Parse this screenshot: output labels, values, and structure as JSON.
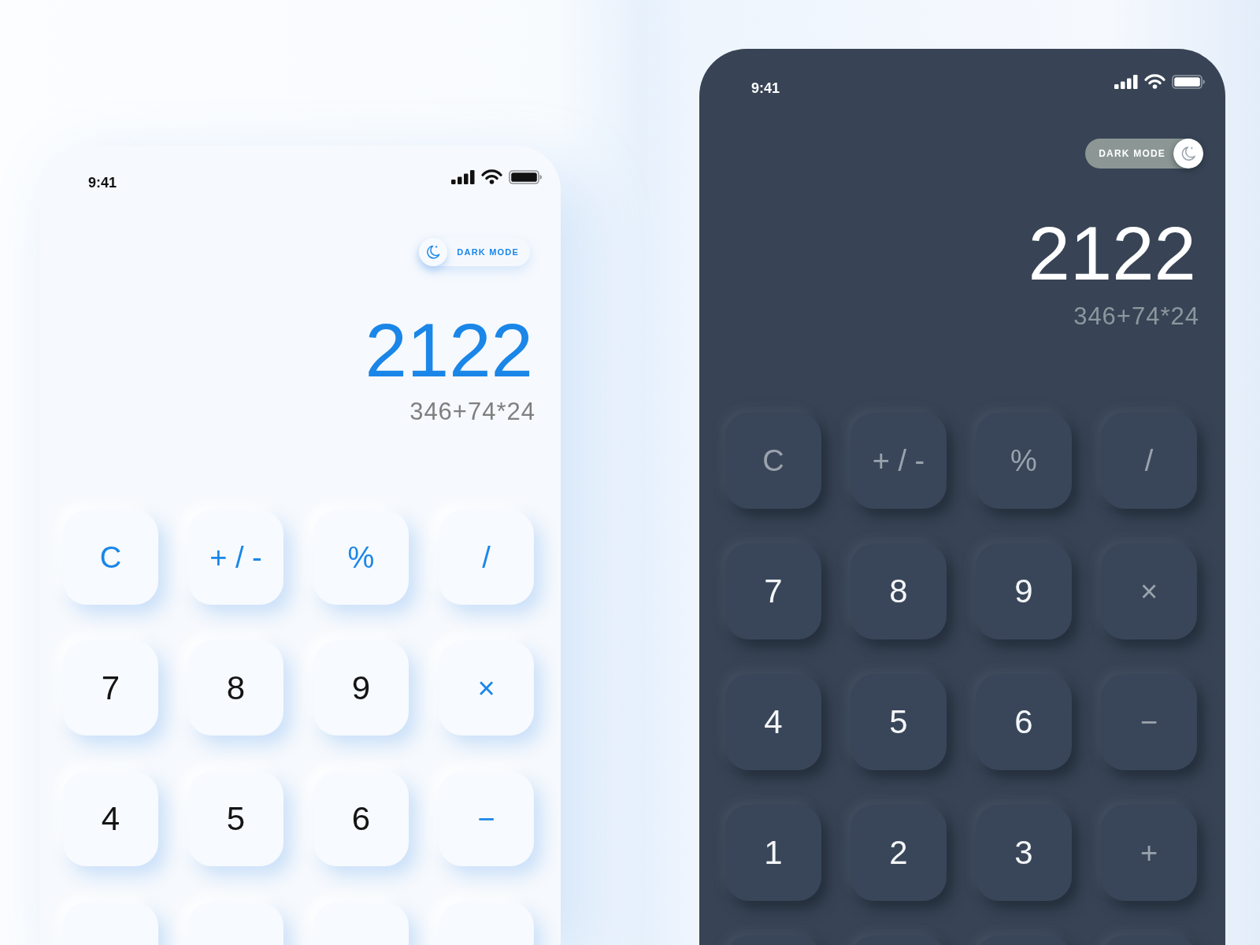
{
  "phones": [
    {
      "status_bar": {
        "time": "9:41"
      },
      "dark_mode_toggle": {
        "label": "DARK MODE",
        "on": false
      },
      "display": {
        "result": "2122",
        "expression": "346+74*24"
      },
      "keys": [
        {
          "label": "C",
          "kind": "operator"
        },
        {
          "label": "+ / -",
          "kind": "operator"
        },
        {
          "label": "%",
          "kind": "operator"
        },
        {
          "label": "/",
          "kind": "operator"
        },
        {
          "label": "7",
          "kind": "digit"
        },
        {
          "label": "8",
          "kind": "digit"
        },
        {
          "label": "9",
          "kind": "digit"
        },
        {
          "label": "×",
          "kind": "operator"
        },
        {
          "label": "4",
          "kind": "digit"
        },
        {
          "label": "5",
          "kind": "digit"
        },
        {
          "label": "6",
          "kind": "digit"
        },
        {
          "label": "−",
          "kind": "operator"
        },
        {
          "kind": "digit"
        },
        {
          "kind": "digit"
        },
        {
          "kind": "digit"
        },
        {
          "kind": "operator"
        }
      ]
    },
    {
      "status_bar": {
        "time": "9:41"
      },
      "dark_mode_toggle": {
        "label": "DARK MODE",
        "on": true
      },
      "display": {
        "result": "2122",
        "expression": "346+74*24"
      },
      "keys": [
        {
          "label": "C",
          "kind": "operator"
        },
        {
          "label": "+ / -",
          "kind": "operator"
        },
        {
          "label": "%",
          "kind": "operator"
        },
        {
          "label": "/",
          "kind": "operator"
        },
        {
          "label": "7",
          "kind": "digit"
        },
        {
          "label": "8",
          "kind": "digit"
        },
        {
          "label": "9",
          "kind": "digit"
        },
        {
          "label": "×",
          "kind": "operator"
        },
        {
          "label": "4",
          "kind": "digit"
        },
        {
          "label": "5",
          "kind": "digit"
        },
        {
          "label": "6",
          "kind": "digit"
        },
        {
          "label": "−",
          "kind": "operator"
        },
        {
          "label": "1",
          "kind": "digit"
        },
        {
          "label": "2",
          "kind": "digit"
        },
        {
          "label": "3",
          "kind": "digit"
        },
        {
          "label": "+",
          "kind": "operator"
        },
        {
          "kind": "digit"
        },
        {
          "kind": "digit"
        },
        {
          "kind": "digit"
        },
        {
          "kind": "operator"
        }
      ]
    }
  ]
}
